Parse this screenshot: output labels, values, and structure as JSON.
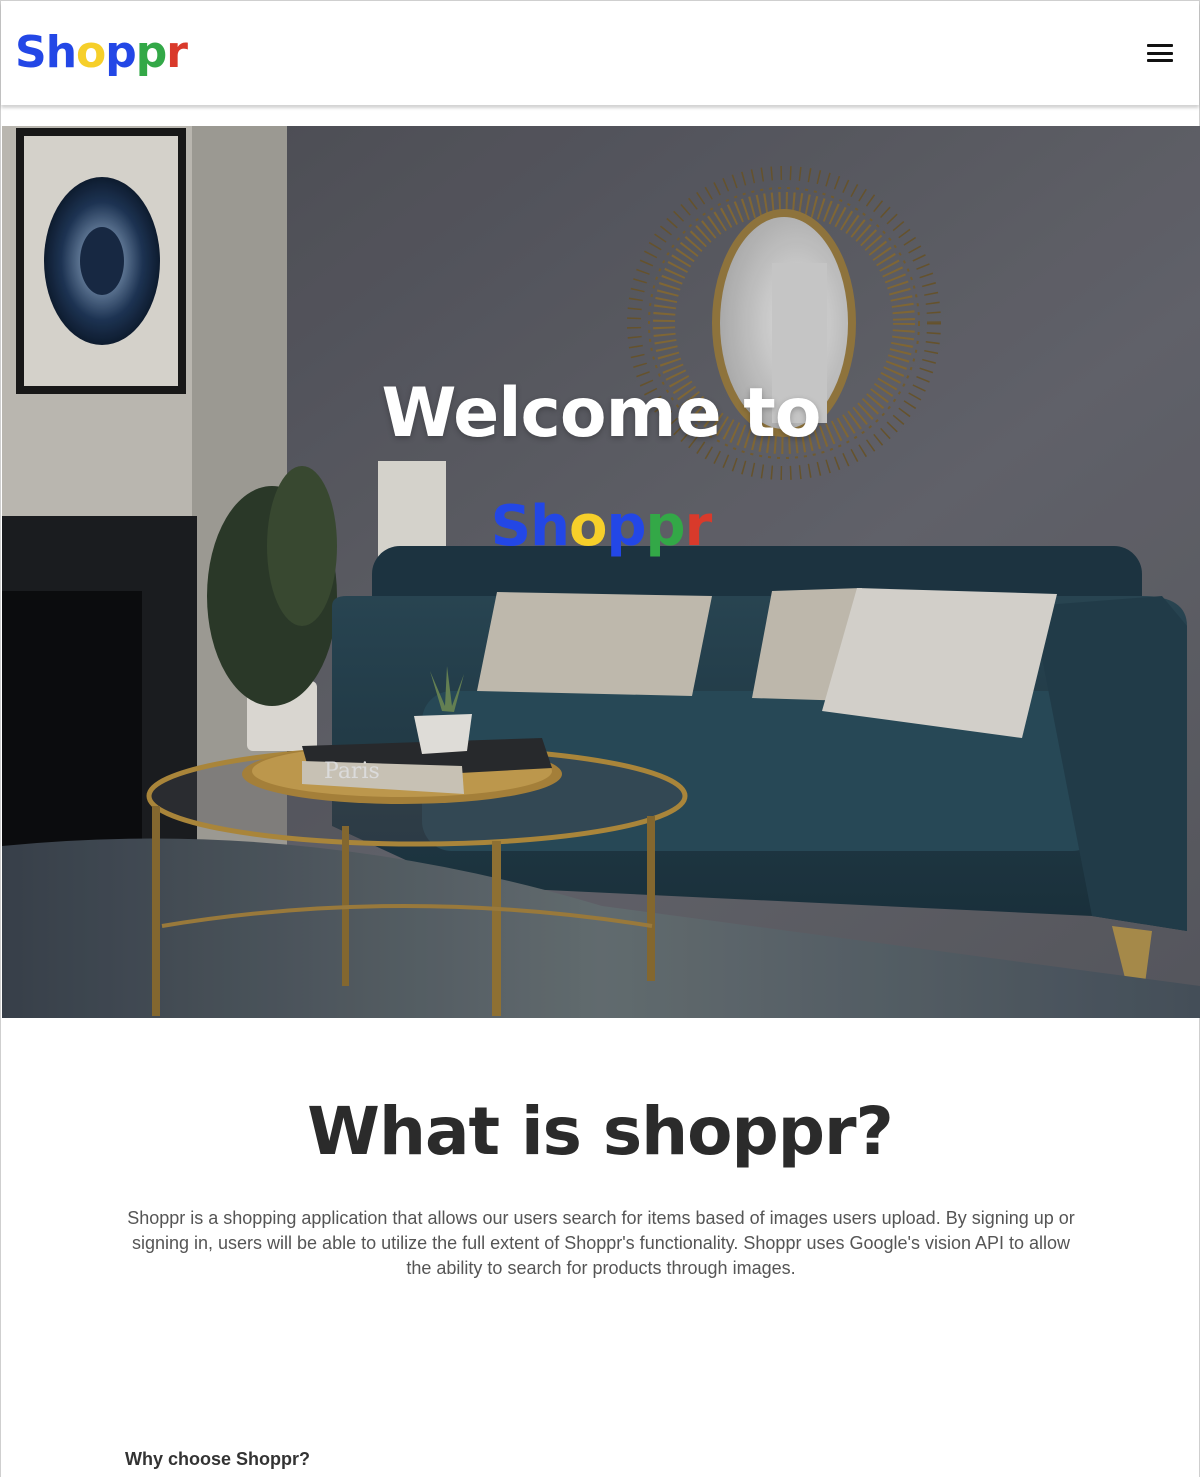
{
  "header": {
    "logo_letters": [
      "S",
      "h",
      "o",
      "p",
      "p",
      "r"
    ],
    "menu_icon": "hamburger-menu-icon"
  },
  "brand_colors": [
    "#2347e6",
    "#2347e6",
    "#f6cf2a",
    "#2347e6",
    "#33a847",
    "#d93a2b"
  ],
  "hero": {
    "title": "Welcome to",
    "logo_letters": [
      "S",
      "h",
      "o",
      "p",
      "p",
      "r"
    ],
    "book_title": "Paris"
  },
  "about": {
    "title": "What is shoppr?",
    "description": "Shoppr is a shopping application that allows our users search for items based of images users upload. By signing up or signing in, users will be able to utilize the full extent of Shoppr's functionality. Shoppr uses Google's vision API to allow the ability to search for products through images."
  },
  "why": {
    "heading": "Why choose Shoppr?"
  }
}
